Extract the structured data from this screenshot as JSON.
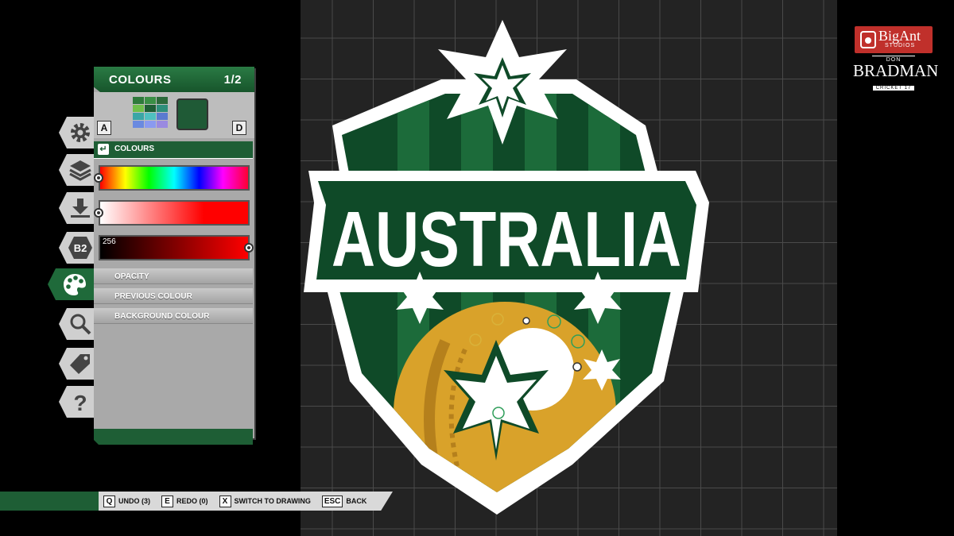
{
  "panel": {
    "title": "COLOURS",
    "page": "1/2",
    "key_left": "A",
    "key_right": "D",
    "section_label": "COLOURS",
    "value_readout": "256",
    "menu_items": [
      {
        "label": "OPACITY"
      },
      {
        "label": "PREVIOUS COLOUR"
      },
      {
        "label": "BACKGROUND COLOUR"
      }
    ]
  },
  "tools": [
    {
      "icon": "gear-icon"
    },
    {
      "icon": "layers-icon"
    },
    {
      "icon": "download-icon"
    },
    {
      "icon": "b2-icon",
      "label": "B2"
    },
    {
      "icon": "palette-icon",
      "active": true
    },
    {
      "icon": "search-icon"
    },
    {
      "icon": "tag-icon"
    },
    {
      "icon": "help-icon",
      "label": "?"
    }
  ],
  "bottom_hints": [
    {
      "key": "Q",
      "label": "UNDO (3)"
    },
    {
      "key": "E",
      "label": "REDO (0)"
    },
    {
      "key": "X",
      "label": "SWITCH TO DRAWING"
    },
    {
      "key": "ESC",
      "label": "BACK"
    }
  ],
  "canvas": {
    "logo_text": "AUSTRALIA"
  },
  "branding": {
    "bigant": "BigAnt",
    "bigant_sub": "STUDIOS",
    "bradman_top": "DON",
    "bradman_name": "BRADMAN",
    "bradman_sub": "CRICKET 17"
  },
  "colors": {
    "accent_green": "#1e5e35",
    "logo_dark_green": "#0f4a28",
    "logo_mid_green": "#1c6b3a",
    "ball_gold": "#d9a22a",
    "bigant_red": "#c0302b"
  }
}
